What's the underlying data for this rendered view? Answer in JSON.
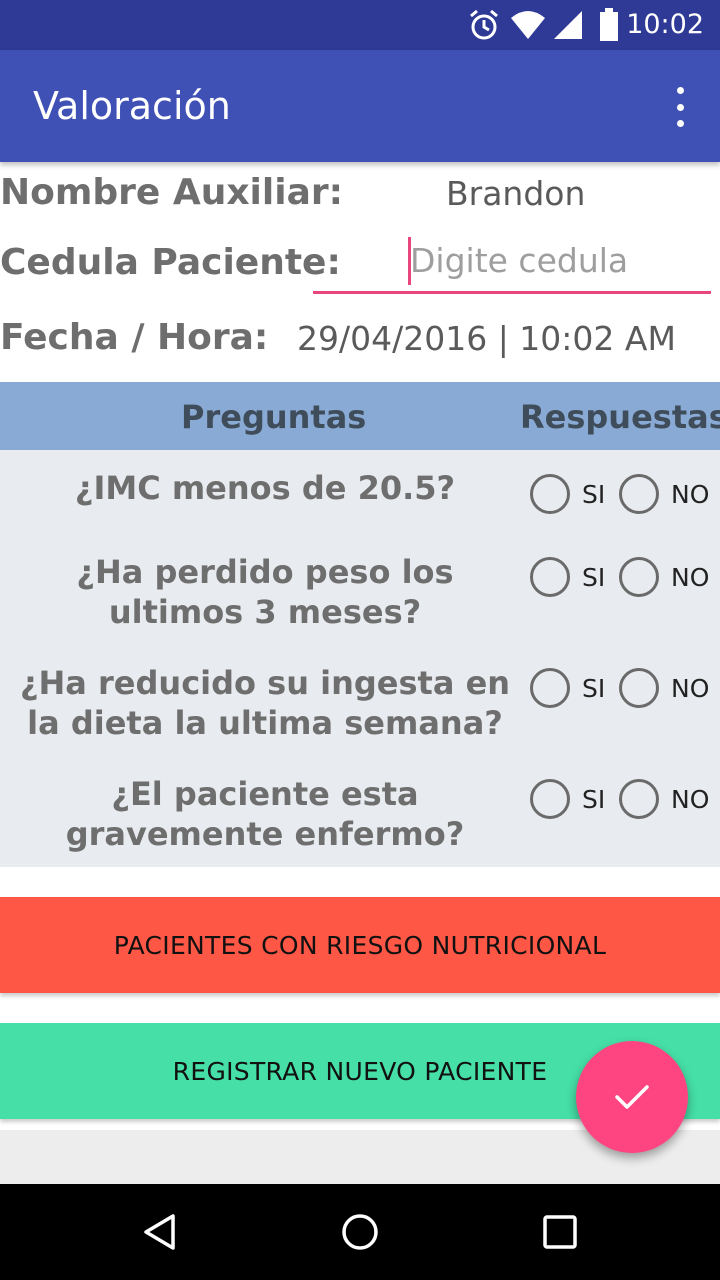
{
  "status_bar": {
    "time": "10:02",
    "icons": [
      "alarm-icon",
      "wifi-icon",
      "signal-icon",
      "battery-icon"
    ]
  },
  "app_bar": {
    "title": "Valoración",
    "menu_icon": "more-vert-icon"
  },
  "form": {
    "auxiliar_label": "Nombre Auxiliar:",
    "auxiliar_value": "Brandon",
    "cedula_label": "Cedula Paciente:",
    "cedula_value": "",
    "cedula_placeholder": "Digite cedula",
    "fecha_label": "Fecha / Hora:",
    "fecha_value": "29/04/2016 | 10:02 AM"
  },
  "table": {
    "header_questions": "Preguntas",
    "header_answers": "Respuestas",
    "option_yes": "SI",
    "option_no": "NO",
    "questions": [
      {
        "text": "¿IMC menos de 20.5?",
        "answer": null
      },
      {
        "text": "¿Ha perdido peso los ultimos 3 meses?",
        "answer": null
      },
      {
        "text": "¿Ha reducido su ingesta en la dieta la ultima semana?",
        "answer": null
      },
      {
        "text": "¿El paciente esta gravemente enfermo?",
        "answer": null
      }
    ]
  },
  "buttons": {
    "risk_label": "PACIENTES CON RIESGO NUTRICIONAL",
    "register_label": "REGISTRAR NUEVO PACIENTE"
  },
  "fab": {
    "icon": "check-icon"
  },
  "colors": {
    "primary": "#3f51b5",
    "primary_dark": "#2f3a96",
    "accent": "#ff4581",
    "table_header": "#8aaad6",
    "risk_button": "#ff5745",
    "register_button": "#46dfa8"
  },
  "nav_bar": {
    "icons": [
      "back-icon",
      "home-icon",
      "recents-icon"
    ]
  }
}
